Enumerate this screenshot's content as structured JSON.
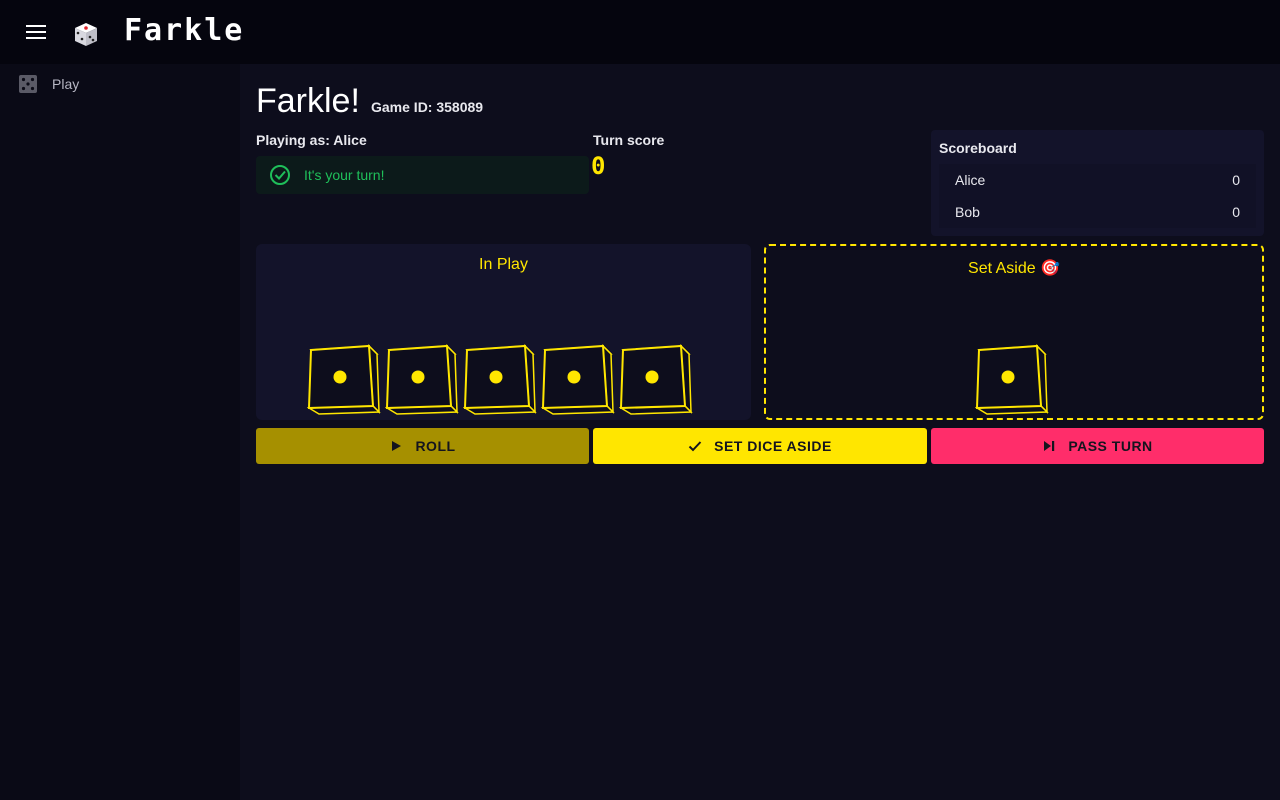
{
  "app": {
    "title": "Farkle",
    "menu_icon": "hamburger-menu-icon",
    "logo_icon": "die-icon"
  },
  "sidebar": {
    "items": [
      {
        "label": "Play",
        "icon": "dice-icon",
        "selected": true
      }
    ]
  },
  "game": {
    "heading": "Farkle!",
    "game_id_label": "Game ID: 358089",
    "playing_as_prefix": "Playing as: ",
    "player_name": "Alice",
    "turn_status": "It's your turn!",
    "turn_score_label": "Turn score",
    "turn_score_value": "0"
  },
  "scoreboard": {
    "title": "Scoreboard",
    "players": [
      {
        "name": "Alice",
        "score": "0"
      },
      {
        "name": "Bob",
        "score": "0"
      }
    ]
  },
  "zones": {
    "in_play": {
      "title": "In Play",
      "dice_values": [
        1,
        1,
        1,
        1,
        1
      ]
    },
    "set_aside": {
      "title": "Set Aside 🎯",
      "dice_values": [
        1
      ]
    }
  },
  "actions": {
    "roll": "ROLL",
    "set_aside": "SET DICE ASIDE",
    "pass_turn": "PASS TURN"
  },
  "colors": {
    "accent_yellow": "#ffe600",
    "roll_button": "#a69000",
    "pass_button": "#ff2d6a",
    "success_green": "#1fbf5a",
    "background": "#0d0d1c"
  }
}
